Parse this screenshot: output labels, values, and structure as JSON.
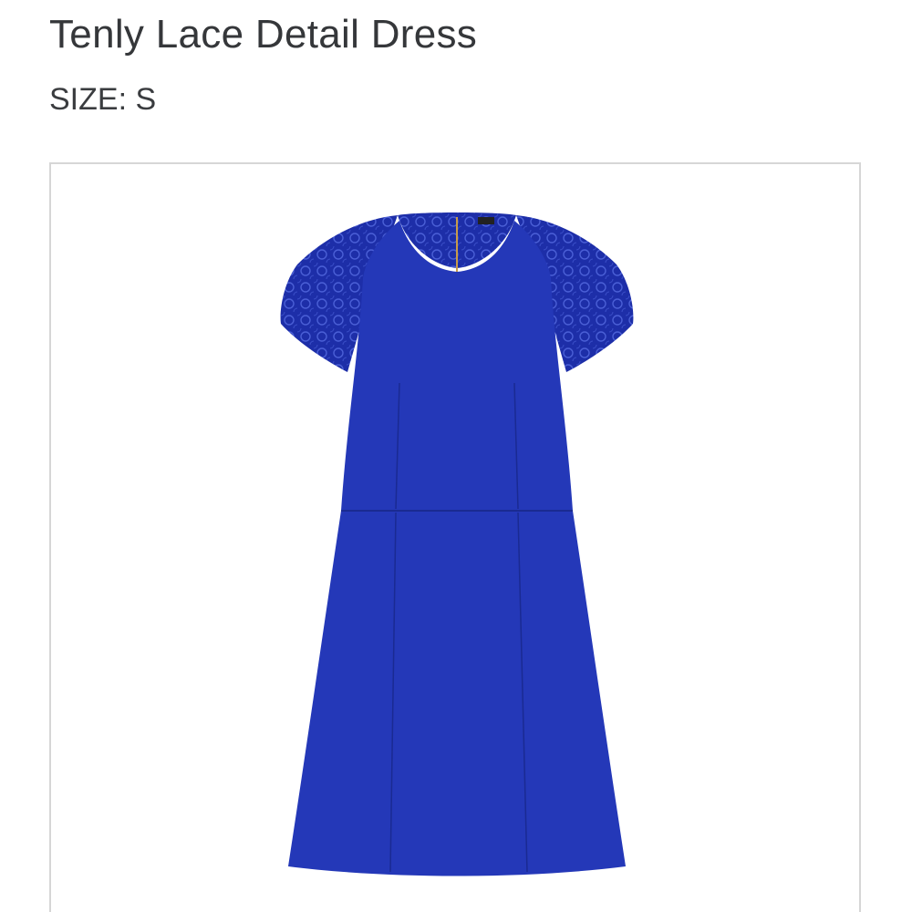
{
  "product": {
    "name": "Tenly Lace Detail Dress",
    "size_label": "SIZE:",
    "size_value": "S",
    "image": {
      "icon": "dress-photo",
      "dress_color": "#2438b8",
      "dress_shadow_color": "#1a2a92",
      "lace_color": "#1e2fa6"
    }
  }
}
